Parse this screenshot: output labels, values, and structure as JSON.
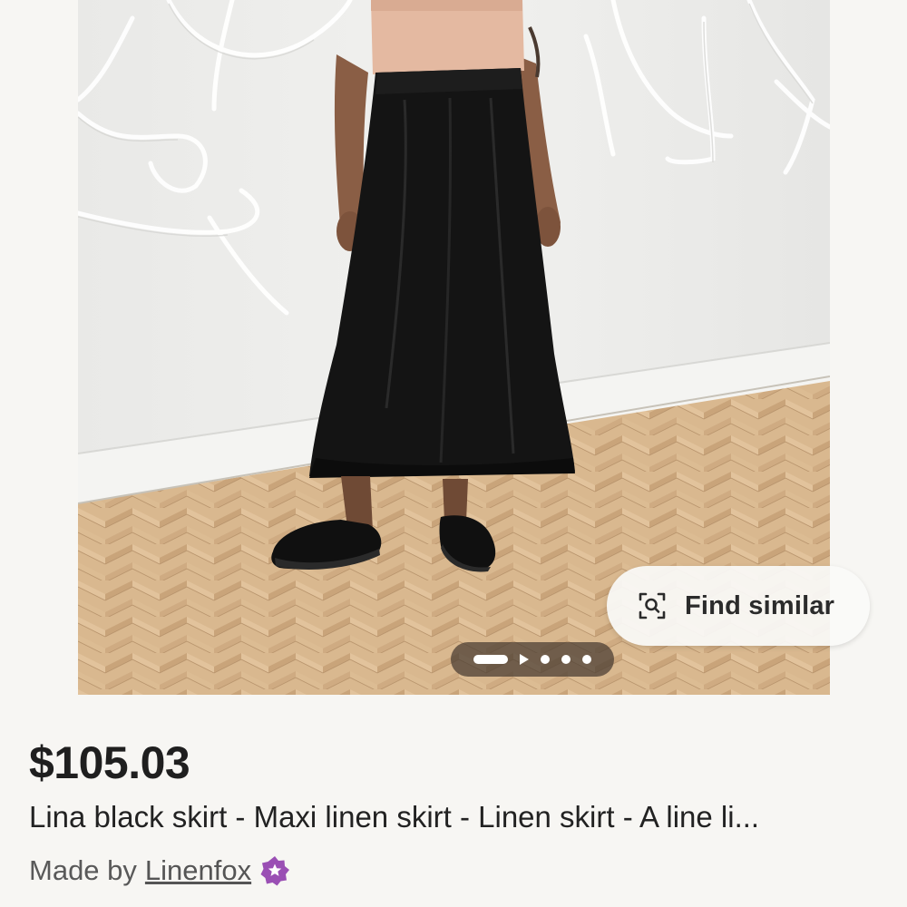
{
  "listing": {
    "price": "$105.03",
    "title": "Lina black skirt - Maxi linen skirt - Linen skirt - A line li...",
    "made_by_prefix": "Made by",
    "shop_name": "Linenfox"
  },
  "image_overlay": {
    "find_similar_label": "Find similar",
    "find_similar_icon": "visual-search-icon"
  },
  "carousel": {
    "active_index": 0,
    "indicators": [
      "active-bar",
      "video-play",
      "dot",
      "dot",
      "dot"
    ]
  },
  "badges": {
    "star_seller_icon": "star-seller-badge-icon",
    "star_seller_color": "#9a4fb4"
  },
  "colors": {
    "background": "#f7f6f3",
    "text_primary": "#222222",
    "text_secondary": "#595959",
    "pill_background": "#fafaf8",
    "carousel_pill": "#463a30"
  }
}
